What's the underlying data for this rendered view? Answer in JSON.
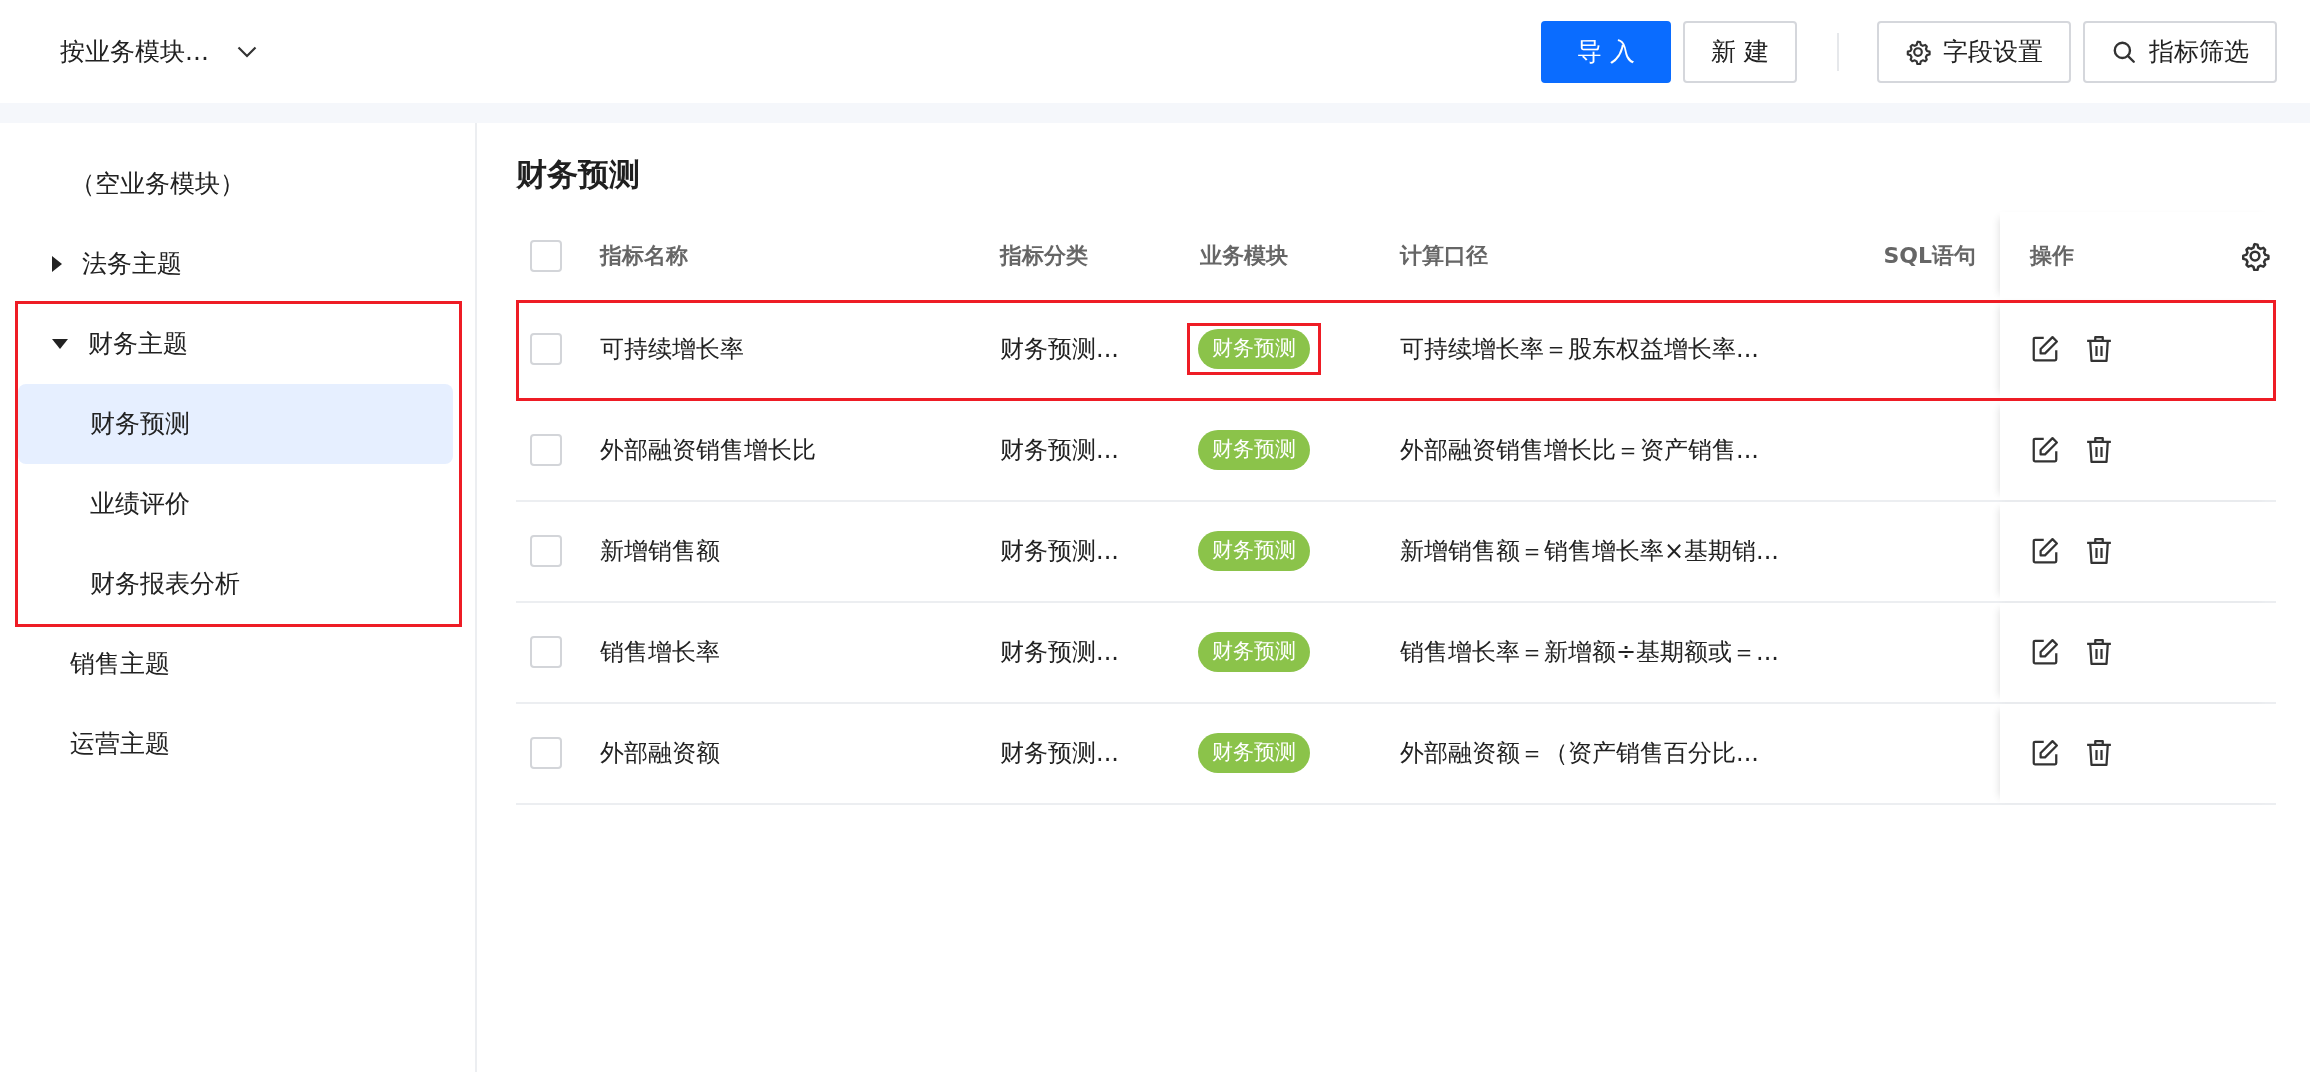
{
  "toolbar": {
    "module_select": {
      "value": "按业务模块..."
    },
    "buttons": [
      {
        "label": "导 入",
        "kind": "primary"
      },
      {
        "label": "新 建",
        "kind": "default"
      },
      {
        "label": "字段设置",
        "kind": "settings"
      },
      {
        "label": "指标筛选",
        "kind": "search"
      }
    ]
  },
  "sidebar": {
    "items": [
      {
        "label": "（空业务模块）",
        "selected": false,
        "highlighted": false
      },
      {
        "label": "法务主题",
        "expanded": false,
        "selected": false,
        "highlighted": false
      },
      {
        "label": "财务主题",
        "expanded": true,
        "selected": false,
        "highlighted": true,
        "children": [
          {
            "label": "财务预测",
            "selected": true
          },
          {
            "label": "业绩评价",
            "selected": false
          },
          {
            "label": "财务报表分析",
            "selected": false
          }
        ]
      },
      {
        "label": "销售主题",
        "selected": false,
        "highlighted": false
      },
      {
        "label": "运营主题",
        "selected": false,
        "highlighted": false
      }
    ]
  },
  "table": {
    "title": "财务预测",
    "select_all": {
      "checked": false
    },
    "columns": [
      "指标名称",
      "指标分类",
      "业务模块",
      "计算口径",
      "SQL语句",
      "操作"
    ],
    "rows": [
      {
        "checked": false,
        "highlighted": true,
        "name": "可持续增长率",
        "category": "财务预测...",
        "module": {
          "label": "财务预测",
          "highlighted": true
        },
        "formula": "可持续增长率＝股东权益增长率..."
      },
      {
        "checked": false,
        "highlighted": false,
        "name": "外部融资销售增长比",
        "category": "财务预测...",
        "module": {
          "label": "财务预测",
          "highlighted": false
        },
        "formula": "外部融资销售增长比＝资产销售..."
      },
      {
        "checked": false,
        "highlighted": false,
        "name": "新增销售额",
        "category": "财务预测...",
        "module": {
          "label": "财务预测",
          "highlighted": false
        },
        "formula": "新增销售额＝销售增长率×基期销..."
      },
      {
        "checked": false,
        "highlighted": false,
        "name": "销售增长率",
        "category": "财务预测...",
        "module": {
          "label": "财务预测",
          "highlighted": false
        },
        "formula": "销售增长率＝新增额÷基期额或＝..."
      },
      {
        "checked": false,
        "highlighted": false,
        "name": "外部融资额",
        "category": "财务预测...",
        "module": {
          "label": "财务预测",
          "highlighted": false
        },
        "formula": "外部融资额＝（资产销售百分比..."
      }
    ]
  }
}
